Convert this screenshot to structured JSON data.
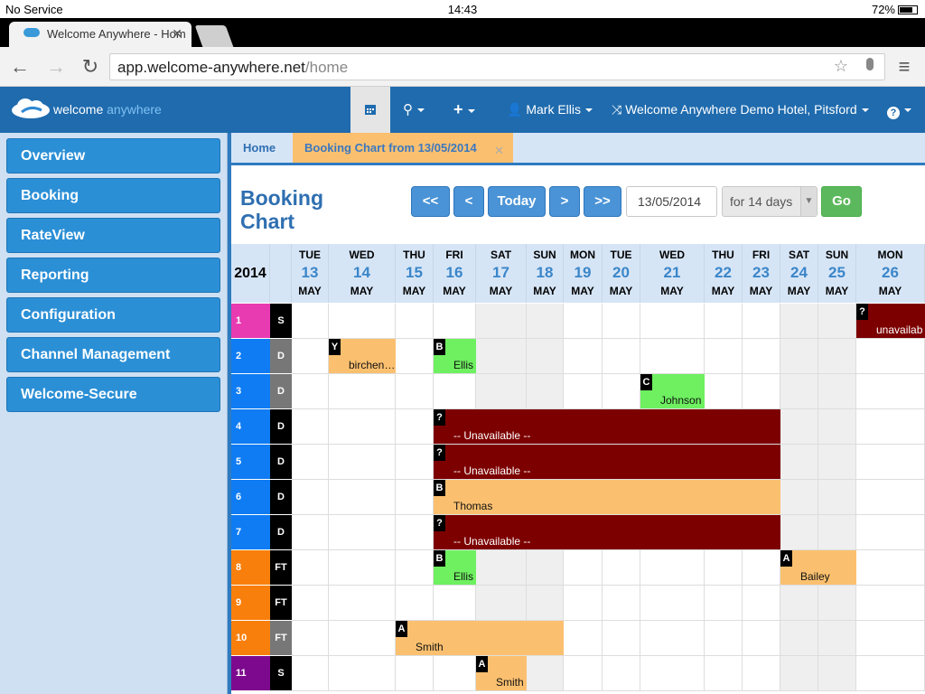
{
  "status_bar": {
    "carrier": "No Service",
    "time": "14:43",
    "battery": "72%"
  },
  "browser": {
    "tab_title": "Welcome Anywhere - Hom",
    "url_host": "app.welcome-anywhere.net",
    "url_path": "/home"
  },
  "app_nav": {
    "brand_a": "welcome",
    "brand_b": "anywhere",
    "user": "Mark Ellis",
    "hotel": "Welcome Anywhere Demo Hotel, Pitsford"
  },
  "sidebar": {
    "items": [
      {
        "label": "Overview"
      },
      {
        "label": "Booking"
      },
      {
        "label": "RateView"
      },
      {
        "label": "Reporting"
      },
      {
        "label": "Configuration"
      },
      {
        "label": "Channel Management"
      },
      {
        "label": "Welcome-Secure"
      }
    ]
  },
  "page_tabs": {
    "home": "Home",
    "active": "Booking Chart from 13/05/2014"
  },
  "page": {
    "title_line1": "Booking",
    "title_line2": "Chart"
  },
  "nav_controls": {
    "first": "<<",
    "prev": "<",
    "today": "Today",
    "next": ">",
    "last": ">>",
    "date_value": "13/05/2014",
    "days_value": "for 14 days",
    "go": "Go"
  },
  "chart": {
    "year": "2014",
    "days": [
      {
        "dow": "TUE",
        "num": "13",
        "mon": "MAY"
      },
      {
        "dow": "WED",
        "num": "14",
        "mon": "MAY"
      },
      {
        "dow": "THU",
        "num": "15",
        "mon": "MAY"
      },
      {
        "dow": "FRI",
        "num": "16",
        "mon": "MAY"
      },
      {
        "dow": "SAT",
        "num": "17",
        "mon": "MAY"
      },
      {
        "dow": "SUN",
        "num": "18",
        "mon": "MAY"
      },
      {
        "dow": "MON",
        "num": "19",
        "mon": "MAY"
      },
      {
        "dow": "TUE",
        "num": "20",
        "mon": "MAY"
      },
      {
        "dow": "WED",
        "num": "21",
        "mon": "MAY"
      },
      {
        "dow": "THU",
        "num": "22",
        "mon": "MAY"
      },
      {
        "dow": "FRI",
        "num": "23",
        "mon": "MAY"
      },
      {
        "dow": "SAT",
        "num": "24",
        "mon": "MAY"
      },
      {
        "dow": "SUN",
        "num": "25",
        "mon": "MAY"
      },
      {
        "dow": "MON",
        "num": "26",
        "mon": "MAY"
      }
    ],
    "rooms": [
      {
        "num": "1",
        "type": "S",
        "color": "#e83bb2"
      },
      {
        "num": "2",
        "type": "D",
        "color": "#0f7cf3"
      },
      {
        "num": "3",
        "type": "D",
        "color": "#0f7cf3"
      },
      {
        "num": "4",
        "type": "D",
        "color": "#0f7cf3"
      },
      {
        "num": "5",
        "type": "D",
        "color": "#0f7cf3"
      },
      {
        "num": "6",
        "type": "D",
        "color": "#0f7cf3"
      },
      {
        "num": "7",
        "type": "D",
        "color": "#0f7cf3"
      },
      {
        "num": "8",
        "type": "FT",
        "color": "#f97f0c"
      },
      {
        "num": "9",
        "type": "FT",
        "color": "#f97f0c"
      },
      {
        "num": "10",
        "type": "FT",
        "color": "#f97f0c"
      },
      {
        "num": "11",
        "type": "S",
        "color": "#7d0a8e"
      }
    ],
    "bookings": [
      {
        "row": 0,
        "start": 13,
        "len": 1,
        "code": "?",
        "name": "unavailab",
        "style": "red"
      },
      {
        "row": 1,
        "start": 1,
        "len": 1,
        "code": "Y",
        "name": "birchen…",
        "style": "org"
      },
      {
        "row": 1,
        "start": 3,
        "len": 1,
        "code": "B",
        "name": "Ellis",
        "style": "grn"
      },
      {
        "row": 2,
        "start": 8,
        "len": 1,
        "code": "C",
        "name": "Johnson",
        "style": "grn"
      },
      {
        "row": 3,
        "start": 3,
        "len": 8,
        "code": "?",
        "name": "-- Unavailable --",
        "style": "red"
      },
      {
        "row": 4,
        "start": 3,
        "len": 8,
        "code": "?",
        "name": "-- Unavailable --",
        "style": "red"
      },
      {
        "row": 5,
        "start": 3,
        "len": 8,
        "code": "B",
        "name": "Thomas",
        "style": "org"
      },
      {
        "row": 6,
        "start": 3,
        "len": 8,
        "code": "?",
        "name": "-- Unavailable --",
        "style": "red"
      },
      {
        "row": 7,
        "start": 3,
        "len": 1,
        "code": "B",
        "name": "Ellis",
        "style": "grn"
      },
      {
        "row": 7,
        "start": 11,
        "len": 2,
        "code": "A",
        "name": "Bailey",
        "style": "org"
      },
      {
        "row": 9,
        "start": 2,
        "len": 4,
        "code": "A",
        "name": "Smith",
        "style": "org"
      },
      {
        "row": 10,
        "start": 4,
        "len": 1,
        "code": "A",
        "name": "Smith",
        "style": "org"
      }
    ]
  }
}
